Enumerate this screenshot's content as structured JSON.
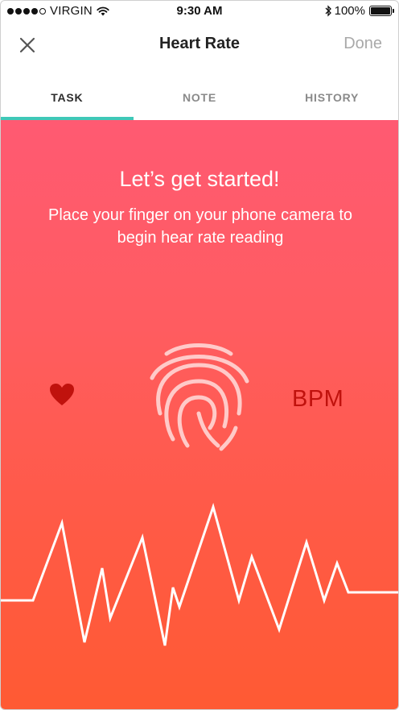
{
  "status_bar": {
    "carrier": "VIRGIN",
    "time": "9:30 AM",
    "battery_text": "100%",
    "battery_level": 1.0
  },
  "nav": {
    "close_icon": "close-icon",
    "title": "Heart Rate",
    "done_label": "Done"
  },
  "tabs": [
    {
      "label": "TASK",
      "active": true
    },
    {
      "label": "NOTE",
      "active": false
    },
    {
      "label": "HISTORY",
      "active": false
    }
  ],
  "hero": {
    "headline": "Let’s get started!",
    "instruction": "Place your finger on your phone camera to begin hear rate reading",
    "heart_icon": "heart-icon",
    "fingerprint_icon": "fingerprint-icon",
    "bpm_label": "BPM"
  },
  "colors": {
    "accent_teal": "#3fc8b8",
    "gradient_top": "#ff5a72",
    "gradient_bottom": "#ff5a33",
    "bpm_red": "#c0120d"
  }
}
